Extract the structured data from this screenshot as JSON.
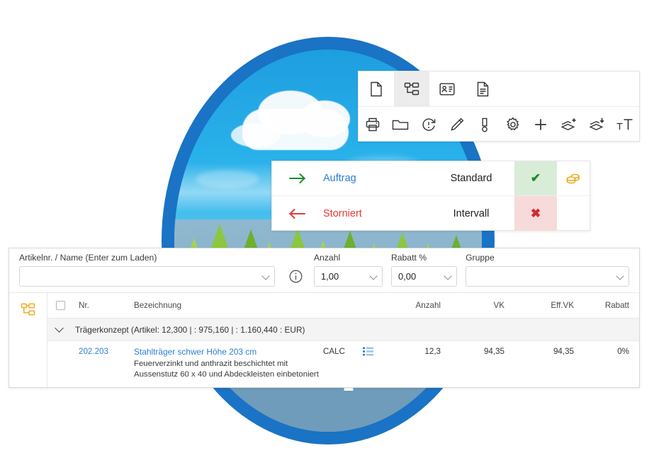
{
  "toolbar": {
    "row1": [
      {
        "name": "new-document-icon",
        "label": "Neu",
        "active": false
      },
      {
        "name": "structure-tree-icon",
        "label": "Struktur",
        "active": true
      },
      {
        "name": "contact-card-icon",
        "label": "Kontakt",
        "active": false
      },
      {
        "name": "document-text-icon",
        "label": "Dokument",
        "active": false
      }
    ],
    "row2": [
      {
        "name": "print-icon",
        "label": "Drucken"
      },
      {
        "name": "folder-icon",
        "label": "Ordner"
      },
      {
        "name": "refresh-alert-icon",
        "label": "Aktualisieren"
      },
      {
        "name": "pencil-icon",
        "label": "Bearbeiten"
      },
      {
        "name": "thermometer-icon",
        "label": "Status"
      },
      {
        "name": "gear-icon",
        "label": "Einstellungen"
      },
      {
        "name": "plus-icon",
        "label": "Hinzufügen"
      },
      {
        "name": "layers-add-icon",
        "label": "Ebene hinzufügen"
      },
      {
        "name": "layers-remove-icon",
        "label": "Ebene entfernen"
      },
      {
        "name": "text-size-icon",
        "label": "Textgröße"
      }
    ]
  },
  "status_panel": {
    "rows": [
      {
        "arrow": "arrow-right-icon",
        "arrow_color": "#1c8b2f",
        "name": "Auftrag",
        "type": "Standard",
        "state": "✔",
        "state_kind": "ok",
        "extra_icon": "coins-icon"
      },
      {
        "arrow": "arrow-left-icon",
        "arrow_color": "#e23b3b",
        "name": "Storniert",
        "type": "Intervall",
        "state": "✖",
        "state_kind": "bad",
        "extra_icon": ""
      }
    ]
  },
  "filter_bar": {
    "article": {
      "label": "Artikelnr. / Name (Enter zum Laden)",
      "value": "",
      "placeholder": ""
    },
    "info_icon": "info-icon",
    "anzahl": {
      "label": "Anzahl",
      "value": "1,00"
    },
    "rabatt": {
      "label": "Rabatt %",
      "value": "0,00"
    },
    "gruppe": {
      "label": "Gruppe",
      "value": ""
    }
  },
  "table": {
    "rail_icon": "structure-tree-icon",
    "headers": {
      "check": "",
      "nr": "Nr.",
      "bezeichnung": "Bezeichnung",
      "calc": "",
      "list": "",
      "anzahl": "Anzahl",
      "vk": "VK",
      "effvk": "Eff.VK",
      "rabatt": "Rabatt"
    },
    "group": {
      "label": "Trägerkonzept (Artikel: 12,300 | : 975,160 | : 1.160,440 :  EUR)"
    },
    "rows": [
      {
        "nr": "202.203",
        "title": "Stahlträger schwer Höhe 203 cm",
        "desc_line_1": "Feuerverzinkt und anthrazit beschichtet mit",
        "desc_line_2": "Aussenstutz 60 x 40 und Abdeckleisten einbetoniert",
        "calc": "CALC",
        "list_icon": "list-icon",
        "anzahl": "12,3",
        "vk": "94,35",
        "effvk": "94,35",
        "rabatt": "0%"
      }
    ]
  },
  "colors": {
    "accent_blue": "#2b7fd4",
    "ring_blue": "#1a73c4",
    "ok_green": "#1c8b2f",
    "error_red": "#e23b3b",
    "gold": "#e8a817",
    "ok_bg": "#d8ecd8",
    "bad_bg": "#f7dada"
  }
}
